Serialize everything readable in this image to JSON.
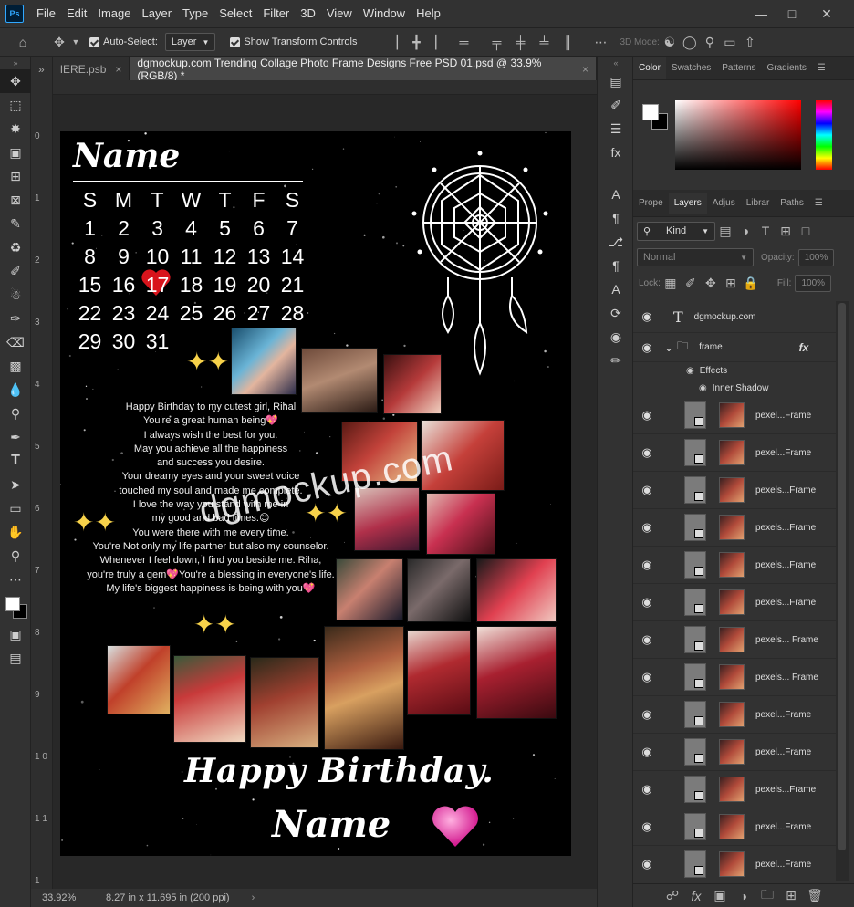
{
  "app": {
    "logo": "Ps"
  },
  "menu": [
    "File",
    "Edit",
    "Image",
    "Layer",
    "Type",
    "Select",
    "Filter",
    "3D",
    "View",
    "Window",
    "Help"
  ],
  "options": {
    "auto_select_label": "Auto-Select:",
    "auto_select_value": "Layer",
    "transform_controls_label": "Show Transform Controls",
    "mode_label": "3D Mode:"
  },
  "tabs": [
    {
      "label": "IERE.psb",
      "active": false
    },
    {
      "label": "dgmockup.com Trending Collage Photo Frame Designs Free PSD 01.psd @ 33.9% (RGB/8) *",
      "active": true
    }
  ],
  "status": {
    "zoom": "33.92%",
    "doc_info": "8.27 in x 11.695 in (200 ppi)"
  },
  "ruler": {
    "marks": [
      "0",
      "1",
      "2",
      "3",
      "4",
      "5",
      "6",
      "7",
      "8",
      "9",
      "1 0",
      "1 1",
      "1"
    ]
  },
  "color_panel": {
    "tabs": [
      "Color",
      "Swatches",
      "Patterns",
      "Gradients"
    ],
    "fg": "#ffffff",
    "bg": "#000000",
    "hue": "#ff0000"
  },
  "layers_panel": {
    "tabs": [
      "Prope",
      "Layers",
      "Adjus",
      "Librar",
      "Paths"
    ],
    "filter_kind": "Kind",
    "blend_mode": "Normal",
    "opacity_label": "Opacity:",
    "opacity_value": "100%",
    "lock_label": "Lock:",
    "fill_label": "Fill:",
    "fill_value": "100%",
    "layers": [
      {
        "name": "dgmockup.com",
        "kind": "text"
      },
      {
        "name": "frame",
        "kind": "group"
      },
      {
        "name": "Effects",
        "kind": "effects"
      },
      {
        "name": "Inner Shadow",
        "kind": "effect"
      },
      {
        "name": "pexel...Frame",
        "kind": "smart"
      },
      {
        "name": "pexel...Frame",
        "kind": "smart"
      },
      {
        "name": "pexels...Frame",
        "kind": "smart"
      },
      {
        "name": "pexels...Frame",
        "kind": "smart"
      },
      {
        "name": "pexels...Frame",
        "kind": "smart"
      },
      {
        "name": "pexels...Frame",
        "kind": "smart"
      },
      {
        "name": "pexels... Frame",
        "kind": "smart"
      },
      {
        "name": "pexels... Frame",
        "kind": "smart"
      },
      {
        "name": "pexel...Frame",
        "kind": "smart"
      },
      {
        "name": "pexel...Frame",
        "kind": "smart"
      },
      {
        "name": "pexels...Frame",
        "kind": "smart"
      },
      {
        "name": "pexel...Frame",
        "kind": "smart"
      },
      {
        "name": "pexel...Frame",
        "kind": "smart"
      }
    ]
  },
  "document": {
    "name_script": "Name",
    "calendar": {
      "days": [
        "S",
        "M",
        "T",
        "W",
        "T",
        "F",
        "S"
      ],
      "weeks": [
        [
          "1",
          "2",
          "3",
          "4",
          "5",
          "6",
          "7"
        ],
        [
          "8",
          "9",
          "10",
          "11",
          "12",
          "13",
          "14"
        ],
        [
          "15",
          "16",
          "17",
          "18",
          "19",
          "20",
          "21"
        ],
        [
          "22",
          "23",
          "24",
          "25",
          "26",
          "27",
          "28"
        ],
        [
          "29",
          "30",
          "31",
          "",
          "",
          "",
          ""
        ]
      ],
      "highlight": "17"
    },
    "message": [
      "Happy Birthday to my cutest girl, Rihal",
      "You're a great human being💖",
      "I always wish the best for you.",
      "May you achieve all the happiness",
      "and success you desire.",
      "Your dreamy eyes and your sweet voice",
      "touched my soul and made me complete.",
      "I love the way you stand with me in",
      "my good and bad times.😊",
      "You were there with me every time.",
      "You're Not only my life partner but also my counselor.",
      "Whenever I feel down, I find you beside me. Riha,",
      "you're truly a gem💖You're a blessing in everyone's life.",
      "My life's biggest happiness is being with you💖"
    ],
    "watermark": "dgmockup.com",
    "happy_birthday": "Happy Birthday.",
    "name_bottom": "Name"
  }
}
